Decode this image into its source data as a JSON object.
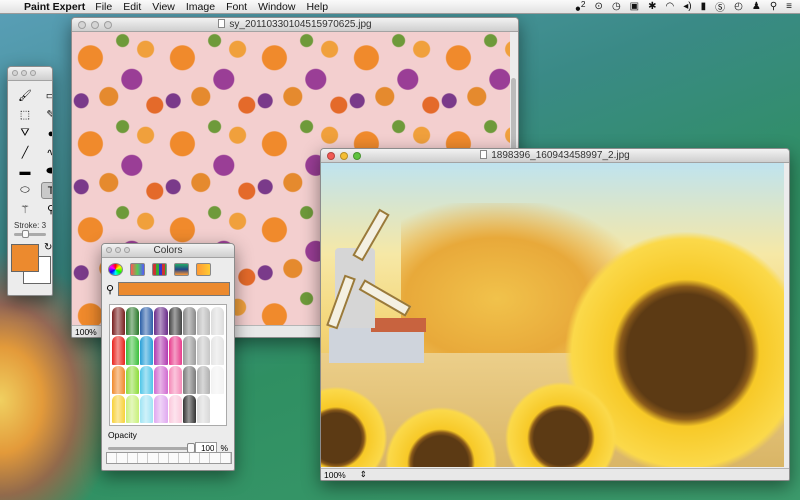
{
  "menubar": {
    "app_name": "Paint Expert",
    "items": [
      "File",
      "Edit",
      "View",
      "Image",
      "Font",
      "Window",
      "Help"
    ],
    "status_badge": "2"
  },
  "floral_window": {
    "title": "sy_20110330104515970625.jpg",
    "zoom": "100%"
  },
  "sunflower_window": {
    "title": "1898396_160943458997_2.jpg",
    "zoom": "100%"
  },
  "tools": {
    "stroke_label": "Stroke: 3",
    "foreground_color": "#ec8a2e",
    "background_color": "#ffffff"
  },
  "colors": {
    "title": "Colors",
    "current_color": "#ec8a2e",
    "opacity_label": "Opacity",
    "opacity_value": "100",
    "opacity_unit": "%",
    "crayon_colors": [
      "#7a1f1f",
      "#2c7a2c",
      "#2c5fa8",
      "#6a2c8a",
      "#444444",
      "#888888",
      "#bbbbbb",
      "#dddddd",
      "#e8231c",
      "#3bbf3b",
      "#28a0d8",
      "#b03ab0",
      "#e83c8c",
      "#9a9a9a",
      "#c6c6c6",
      "#e4e4e4",
      "#f08a2c",
      "#8ddc3a",
      "#4fc6e8",
      "#d06ad0",
      "#f58ab8",
      "#7a7a7a",
      "#b0b0b0",
      "#f2f2f2",
      "#f7d13a",
      "#c9f07a",
      "#9fe4f4",
      "#e0a8f0",
      "#fbc8dc",
      "#333333",
      "#d8d8d8",
      "#ffffff"
    ]
  }
}
